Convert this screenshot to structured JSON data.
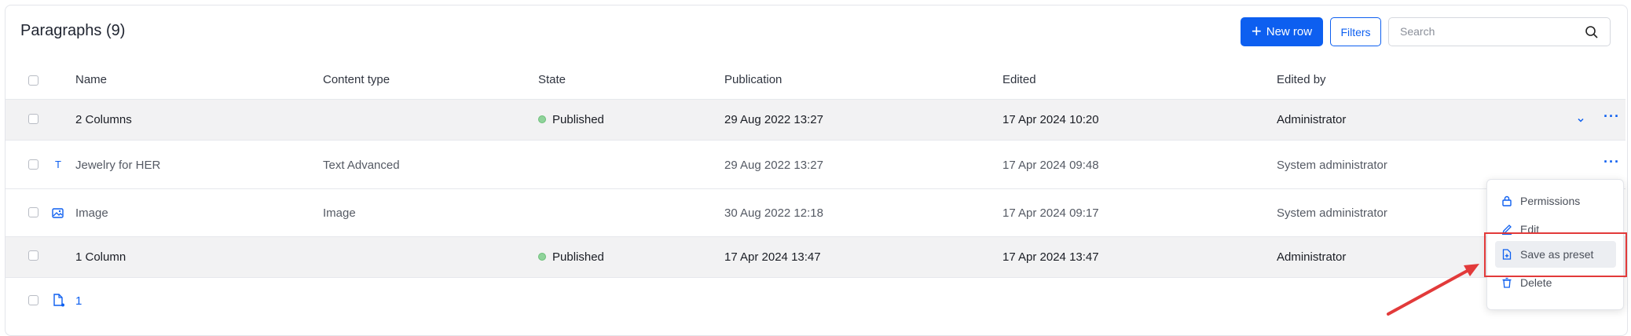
{
  "header": {
    "title": "Paragraphs (9)",
    "new_row_label": "New row",
    "filters_label": "Filters",
    "search_placeholder": "Search"
  },
  "columns": [
    "Name",
    "Content type",
    "State",
    "Publication",
    "Edited",
    "Edited by"
  ],
  "rows": [
    {
      "name": "2 Columns",
      "content_type": "",
      "state": "Published",
      "publication": "29 Aug 2022 13:27",
      "edited": "17 Apr 2024 10:20",
      "edited_by": "Administrator",
      "icon": ""
    },
    {
      "name": "Jewelry for HER",
      "content_type": "Text Advanced",
      "state": "",
      "publication": "29 Aug 2022 13:27",
      "edited": "17 Apr 2024 09:48",
      "edited_by": "System administrator",
      "icon": "T"
    },
    {
      "name": "Image",
      "content_type": "Image",
      "state": "",
      "publication": "30 Aug 2022 12:18",
      "edited": "17 Apr 2024 09:17",
      "edited_by": "System administrator",
      "icon": "image-icon"
    },
    {
      "name": "1 Column",
      "content_type": "",
      "state": "Published",
      "publication": "17 Apr 2024 13:47",
      "edited": "17 Apr 2024 13:47",
      "edited_by": "Administrator",
      "icon": ""
    },
    {
      "name": "1",
      "content_type": "",
      "state": "",
      "publication": "",
      "edited": "",
      "edited_by": "",
      "icon": "document-icon"
    }
  ],
  "context_menu": {
    "items": [
      {
        "label": "Permissions",
        "icon": "lock-icon"
      },
      {
        "label": "Edit",
        "icon": "pencil-icon"
      },
      {
        "label": "Save as preset",
        "icon": "preset-file-icon"
      },
      {
        "label": "Delete",
        "icon": "trash-icon"
      }
    ]
  },
  "colors": {
    "accent": "#0d5ff0",
    "published_dot": "#8fd39a",
    "highlight_box": "#e23a3a"
  }
}
